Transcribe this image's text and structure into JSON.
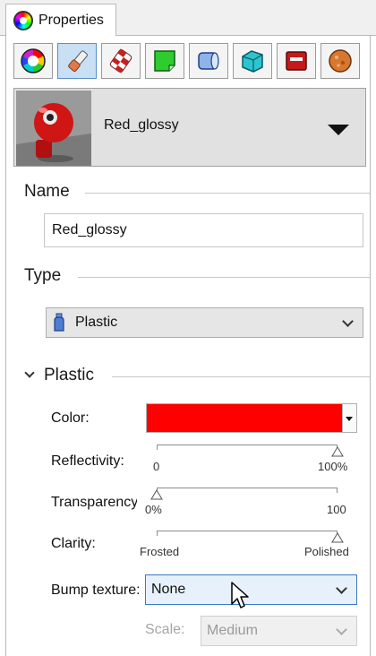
{
  "tab": {
    "title": "Properties",
    "icon": "color-wheel-icon"
  },
  "toolbar": [
    {
      "name": "color-wheel-icon",
      "active": false
    },
    {
      "name": "paintbrush-icon",
      "active": true
    },
    {
      "name": "checker-brush-icon",
      "active": false
    },
    {
      "name": "green-sheet-icon",
      "active": false
    },
    {
      "name": "blue-cylinder-icon",
      "active": false
    },
    {
      "name": "cyan-object-icon",
      "active": false
    },
    {
      "name": "red-box-icon",
      "active": false
    },
    {
      "name": "orange-ball-icon",
      "active": false
    }
  ],
  "material": {
    "name": "Red_glossy",
    "thumbnail": "red-glossy-thumbnail"
  },
  "name_section": {
    "heading": "Name",
    "value": "Red_glossy"
  },
  "type_section": {
    "heading": "Type",
    "value": "Plastic",
    "icon": "plastic-bottle-icon"
  },
  "plastic_section": {
    "heading": "Plastic",
    "color": {
      "label": "Color:",
      "value": "#ff0000"
    },
    "reflectivity": {
      "label": "Reflectivity:",
      "min_label": "0",
      "max_label": "100%",
      "value": 1.0
    },
    "transparency": {
      "label": "Transparency:",
      "min_label": "0%",
      "max_label": "100",
      "value": 0.0
    },
    "clarity": {
      "label": "Clarity:",
      "min_label": "Frosted",
      "max_label": "Polished",
      "value": 1.0
    },
    "bump": {
      "label": "Bump texture:",
      "value": "None"
    },
    "scale": {
      "label": "Scale:",
      "value": "Medium"
    }
  },
  "colors": {
    "accent": "#3b79c4",
    "color_swatch": "#ff0000"
  }
}
